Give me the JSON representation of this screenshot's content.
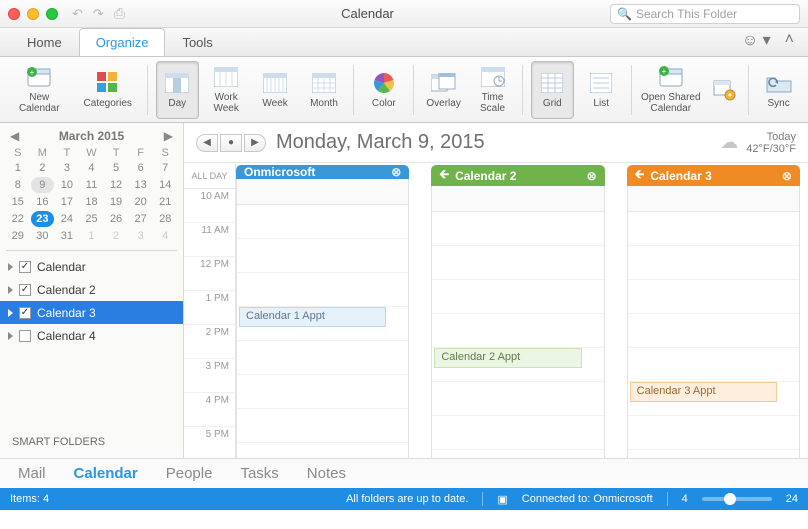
{
  "window": {
    "title": "Calendar",
    "search_placeholder": "Search This Folder"
  },
  "tabs": {
    "home": "Home",
    "organize": "Organize",
    "tools": "Tools",
    "active": "organize"
  },
  "ribbon": {
    "new_calendar": "New\nCalendar",
    "categories": "Categories",
    "day": "Day",
    "work_week": "Work\nWeek",
    "week": "Week",
    "month": "Month",
    "color": "Color",
    "overlay": "Overlay",
    "time_scale": "Time\nScale",
    "grid": "Grid",
    "list": "List",
    "open_shared": "Open Shared\nCalendar",
    "sync": "Sync"
  },
  "mini_calendar": {
    "title": "March 2015",
    "dow": [
      "S",
      "M",
      "T",
      "W",
      "T",
      "F",
      "S"
    ],
    "rows": [
      [
        "1",
        "2",
        "3",
        "4",
        "5",
        "6",
        "7"
      ],
      [
        "8",
        "9",
        "10",
        "11",
        "12",
        "13",
        "14"
      ],
      [
        "15",
        "16",
        "17",
        "18",
        "19",
        "20",
        "21"
      ],
      [
        "22",
        "23",
        "24",
        "25",
        "26",
        "27",
        "28"
      ],
      [
        "29",
        "30",
        "31",
        "1",
        "2",
        "3",
        "4"
      ]
    ],
    "selected": "9",
    "today": "23"
  },
  "calendar_list": {
    "items": [
      {
        "label": "Calendar",
        "checked": true,
        "selected": false
      },
      {
        "label": "Calendar 2",
        "checked": true,
        "selected": false
      },
      {
        "label": "Calendar 3",
        "checked": true,
        "selected": true
      },
      {
        "label": "Calendar 4",
        "checked": false,
        "selected": false
      }
    ],
    "smart_folders": "SMART FOLDERS"
  },
  "main": {
    "date_title": "Monday, March 9, 2015",
    "weather": {
      "label": "Today",
      "temps": "42°F/30°F"
    },
    "all_day_label": "ALL DAY",
    "hours": [
      "10 AM",
      "11 AM",
      "12 PM",
      "1 PM",
      "2 PM",
      "3 PM",
      "4 PM",
      "5 PM"
    ],
    "columns": [
      {
        "name": "Onmicrosoft",
        "color": "blue",
        "appt": "Calendar 1 Appt",
        "has_back": false
      },
      {
        "name": "Calendar 2",
        "color": "green",
        "appt": "Calendar 2 Appt",
        "has_back": true
      },
      {
        "name": "Calendar 3",
        "color": "orange",
        "appt": "Calendar 3 Appt",
        "has_back": true
      }
    ]
  },
  "nav": {
    "mail": "Mail",
    "calendar": "Calendar",
    "people": "People",
    "tasks": "Tasks",
    "notes": "Notes",
    "active": "calendar"
  },
  "status": {
    "items": "Items: 4",
    "sync": "All folders are up to date.",
    "connected": "Connected to: Onmicrosoft",
    "zoom_min": "4",
    "zoom_max": "24"
  }
}
